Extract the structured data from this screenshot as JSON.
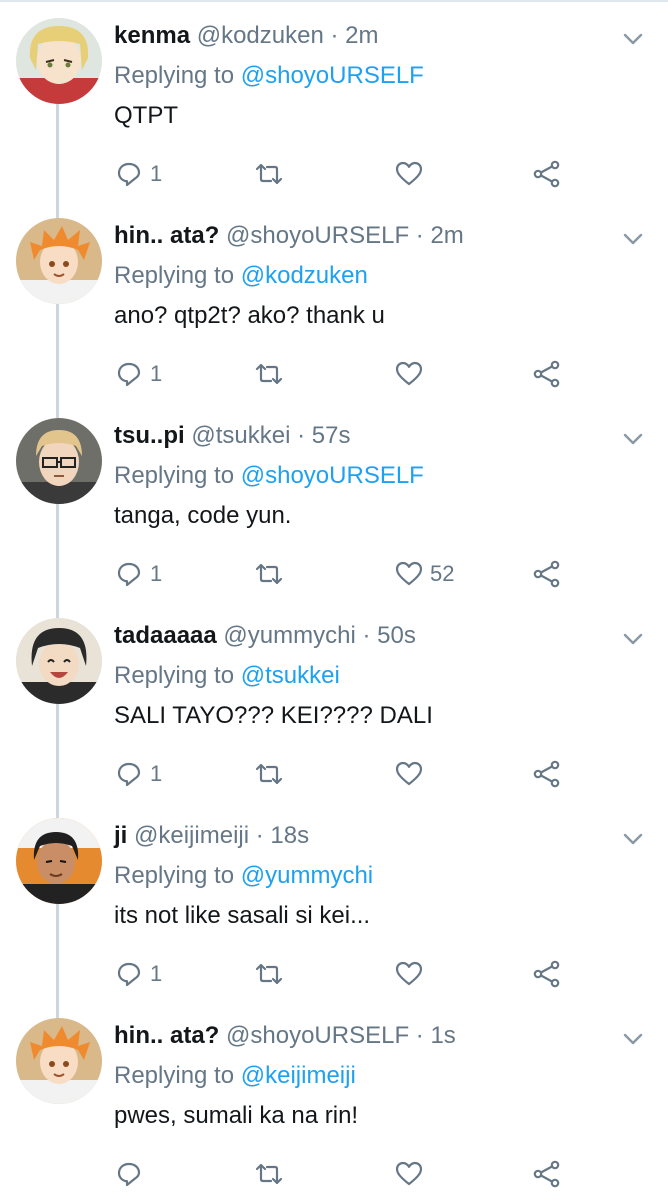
{
  "labels": {
    "replying_to": "Replying to"
  },
  "tweets": [
    {
      "name": "kenma",
      "handle": "@kodzuken",
      "time": "2m",
      "reply_to": "@shoyoURSELF",
      "text": "QTPT",
      "reply_count": "1",
      "retweet_count": "",
      "like_count": "",
      "avatar": "kenma-avatar"
    },
    {
      "name": "hin.. ata?",
      "handle": "@shoyoURSELF",
      "time": "2m",
      "reply_to": "@kodzuken",
      "text": "ano? qtp2t? ako? thank u",
      "reply_count": "1",
      "retweet_count": "",
      "like_count": "",
      "avatar": "hinata-avatar"
    },
    {
      "name": "tsu..pi",
      "handle": "@tsukkei",
      "time": "57s",
      "reply_to": "@shoyoURSELF",
      "text": "tanga, code yun.",
      "reply_count": "1",
      "retweet_count": "",
      "like_count": "52",
      "avatar": "tsukishima-avatar"
    },
    {
      "name": "tadaaaaa",
      "handle": "@yummychi",
      "time": "50s",
      "reply_to": "@tsukkei",
      "text": "SALI TAYO??? KEI???? DALI",
      "reply_count": "1",
      "retweet_count": "",
      "like_count": "",
      "avatar": "yamaguchi-avatar"
    },
    {
      "name": "ji",
      "handle": "@keijimeiji",
      "time": "18s",
      "reply_to": "@yummychi",
      "text": "its not like sasali si kei...",
      "reply_count": "1",
      "retweet_count": "",
      "like_count": "",
      "avatar": "akaashi-avatar"
    },
    {
      "name": "hin.. ata?",
      "handle": "@shoyoURSELF",
      "time": "1s",
      "reply_to": "@keijimeiji",
      "text": "pwes, sumali ka na rin!",
      "reply_count": "",
      "retweet_count": "",
      "like_count": "",
      "avatar": "hinata-avatar"
    }
  ],
  "colors": {
    "mention": "#1da1f2",
    "secondary_text": "#657786",
    "primary_text": "#14171a",
    "thread_line": "#ccd6dd"
  }
}
